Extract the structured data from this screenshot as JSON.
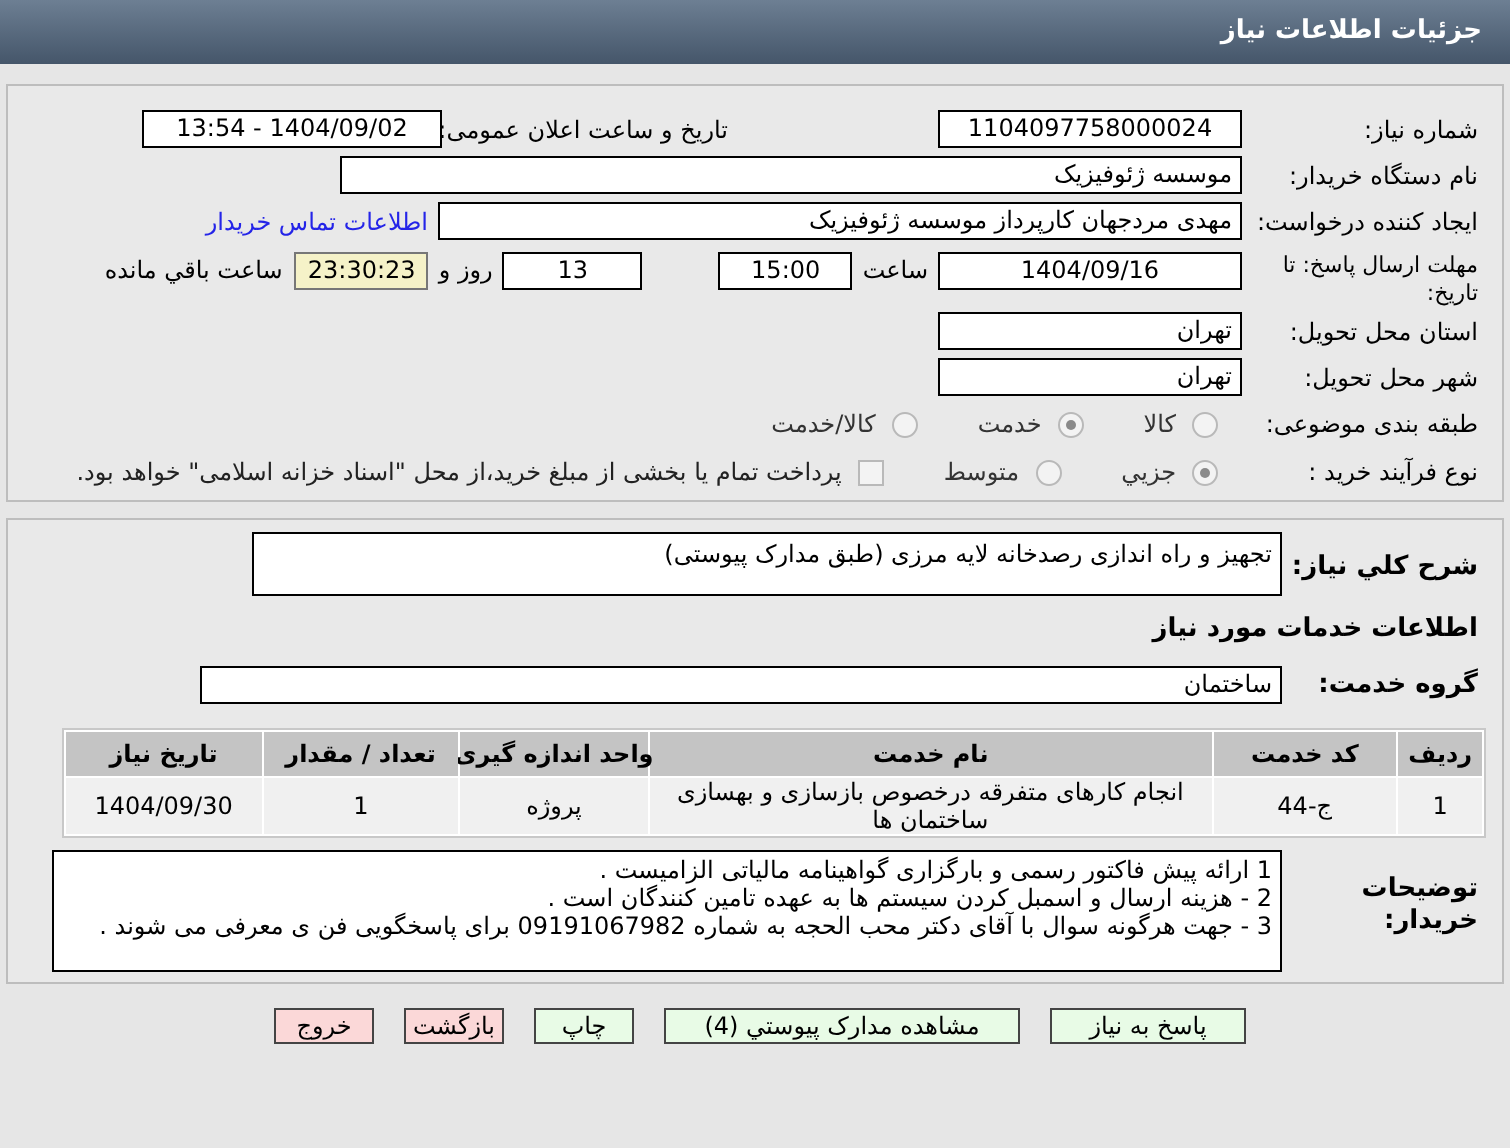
{
  "header": {
    "title": "جزئیات اطلاعات نیاز"
  },
  "need_number": {
    "label": "شماره نیاز:",
    "value": "1104097758000024"
  },
  "announce_date": {
    "label": "تاریخ و ساعت اعلان عمومی:",
    "value": "1404/09/02 - 13:54"
  },
  "buyer": {
    "label": "نام دستگاه خریدار:",
    "value": "موسسه ژئوفیزیک"
  },
  "requester": {
    "label": "ایجاد کننده درخواست:",
    "value": "مهدی مردجهان کارپرداز موسسه ژئوفیزیک",
    "link": "اطلاعات تماس خریدار"
  },
  "deadline": {
    "label": "مهلت ارسال پاسخ: تا تاریخ:",
    "date": "1404/09/16",
    "time_label": "ساعت",
    "time": "15:00",
    "days": "13",
    "days_label": "روز و",
    "remaining": "23:30:23",
    "remaining_label": "ساعت باقي مانده"
  },
  "province": {
    "label": "استان محل تحویل:",
    "value": "تهران"
  },
  "city": {
    "label": "شهر محل تحویل:",
    "value": "تهران"
  },
  "category": {
    "label": "طبقه بندی موضوعی:",
    "options": [
      {
        "label": "کالا",
        "selected": false
      },
      {
        "label": "خدمت",
        "selected": true
      },
      {
        "label": "کالا/خدمت",
        "selected": false
      }
    ]
  },
  "process": {
    "label": "نوع فرآیند خرید :",
    "options": [
      {
        "label": "جزيي",
        "selected": true
      },
      {
        "label": "متوسط",
        "selected": false
      }
    ],
    "payment_checkbox": {
      "checked": false,
      "label": "پرداخت تمام یا بخشی از مبلغ خرید،از محل \"اسناد خزانه اسلامی\" خواهد بود."
    }
  },
  "summary": {
    "label": "شرح کلي نیاز:",
    "value": "تجهیز و راه اندازی رصدخانه لایه مرزی (طبق مدارک پیوستی)"
  },
  "services_heading": "اطلاعات خدمات مورد نیاز",
  "service_group": {
    "label": "گروه خدمت:",
    "value": "ساختمان"
  },
  "table": {
    "columns": [
      "ردیف",
      "کد خدمت",
      "نام خدمت",
      "واحد اندازه گیری",
      "تعداد / مقدار",
      "تاریخ نیاز"
    ],
    "rows": [
      [
        "1",
        "ج-44",
        "انجام کارهای متفرقه درخصوص بازسازی و بهسازی ساختمان ها",
        "پروژه",
        "1",
        "1404/09/30"
      ]
    ]
  },
  "notes": {
    "label": "توضیحات خریدار:",
    "lines": [
      "1 ارائه پیش فاکتور رسمی و بارگزاری گواهینامه مالیاتی الزامیست .",
      "2 - هزینه ارسال و اسمبل کردن سیستم ها به عهده تامین کنندگان است .",
      "3 - جهت هرگونه سوال با آقای دکتر محب الحجه به شماره 09191067982 برای پاسخگویی فن ی معرفی می شوند ."
    ]
  },
  "buttons": [
    {
      "label": "پاسخ به نیاز",
      "kind": "normal"
    },
    {
      "label": "مشاهده مدارک پیوستي (4)",
      "kind": "normal"
    },
    {
      "label": "چاپ",
      "kind": "normal"
    },
    {
      "label": "بازگشت",
      "kind": "danger"
    },
    {
      "label": "خروج",
      "kind": "danger"
    }
  ]
}
